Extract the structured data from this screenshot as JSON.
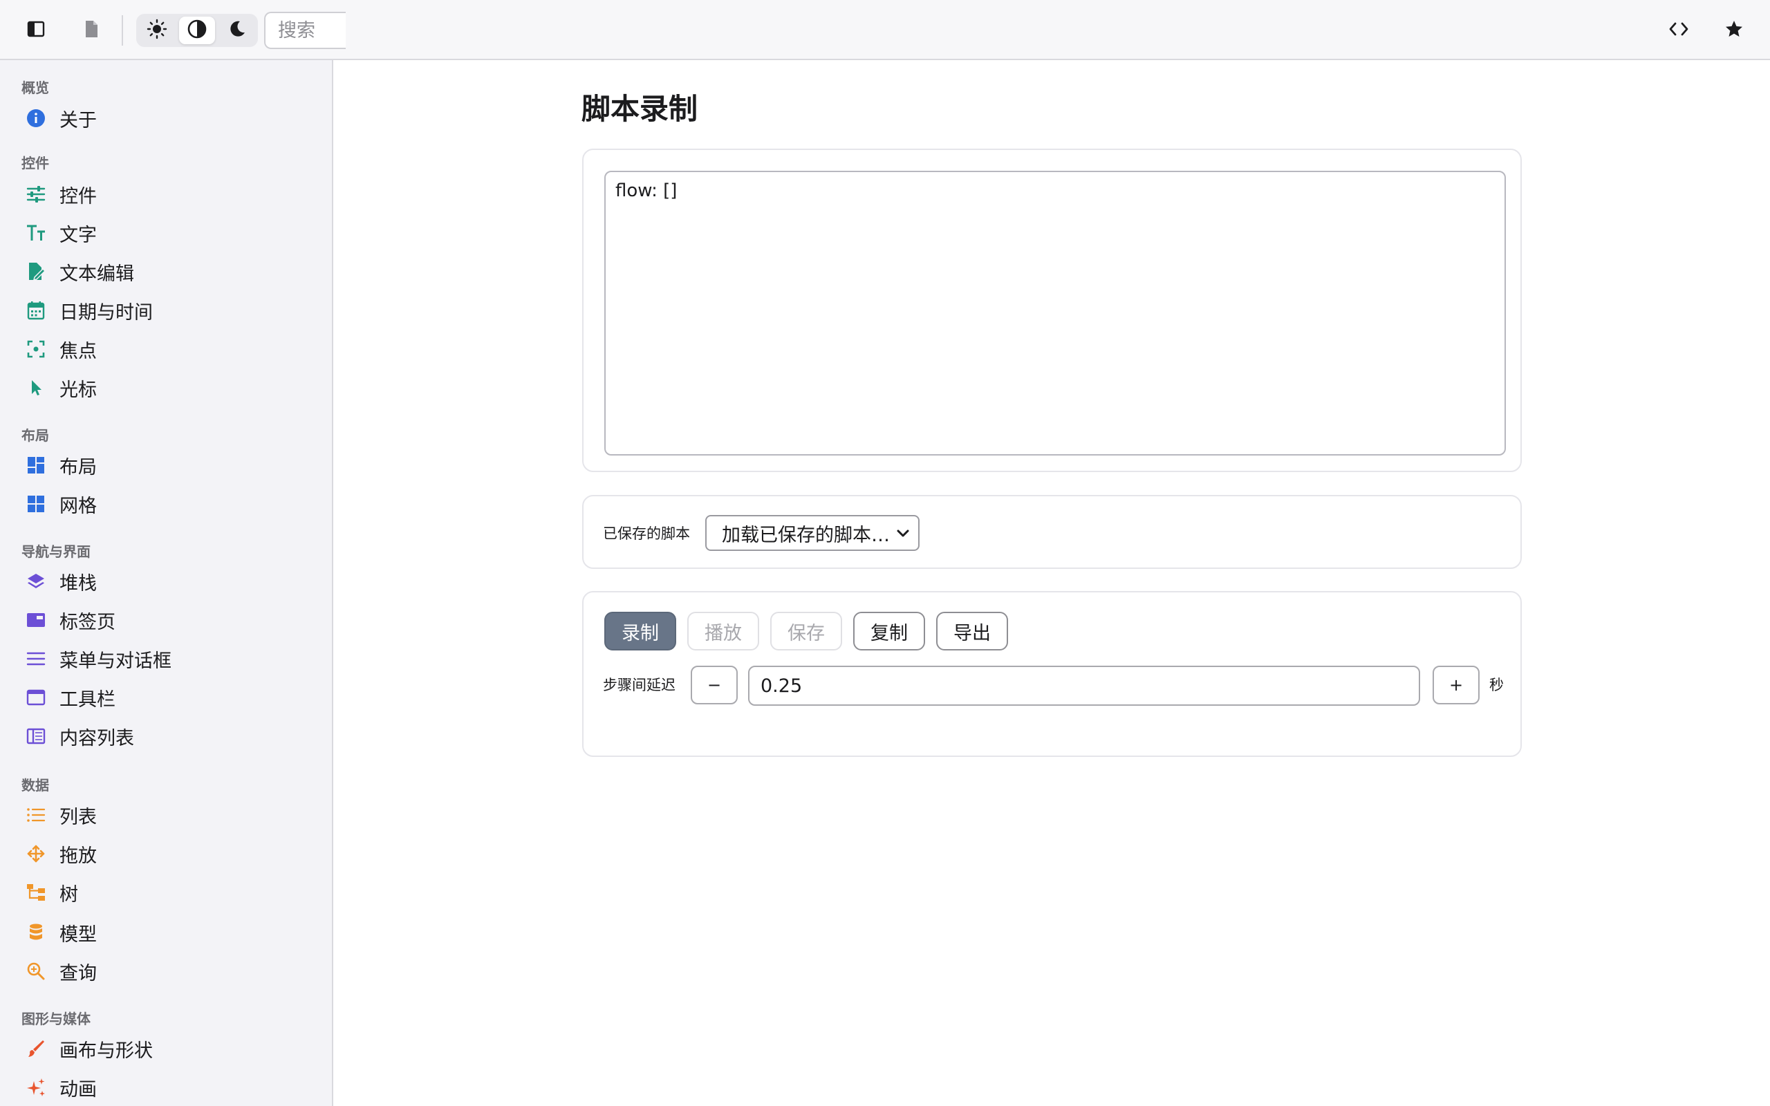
{
  "toolbar": {
    "search_placeholder": "搜索",
    "icons": [
      "sidebar-toggle-icon",
      "document-icon",
      "sun-icon",
      "contrast-icon",
      "moon-icon",
      "code-icon",
      "star-icon"
    ]
  },
  "sidebar": {
    "sections": [
      {
        "title": "概览",
        "items": [
          {
            "label": "关于",
            "icon": "info-icon",
            "color": "#2f6fde"
          }
        ]
      },
      {
        "title": "控件",
        "items": [
          {
            "label": "控件",
            "icon": "sliders-icon",
            "color": "#1f9a7f"
          },
          {
            "label": "文字",
            "icon": "text-size-icon",
            "color": "#1f9a7f"
          },
          {
            "label": "文本编辑",
            "icon": "edit-document-icon",
            "color": "#1f9a7f"
          },
          {
            "label": "日期与时间",
            "icon": "calendar-icon",
            "color": "#1f9a7f"
          },
          {
            "label": "焦点",
            "icon": "focus-icon",
            "color": "#1f9a7f"
          },
          {
            "label": "光标",
            "icon": "cursor-icon",
            "color": "#1f9a7f"
          }
        ]
      },
      {
        "title": "布局",
        "items": [
          {
            "label": "布局",
            "icon": "layout-grid-icon",
            "color": "#2f6fde"
          },
          {
            "label": "网格",
            "icon": "grid-icon",
            "color": "#2f6fde"
          }
        ]
      },
      {
        "title": "导航与界面",
        "items": [
          {
            "label": "堆栈",
            "icon": "stack-icon",
            "color": "#6c4fd6"
          },
          {
            "label": "标签页",
            "icon": "tabs-icon",
            "color": "#6c4fd6"
          },
          {
            "label": "菜单与对话框",
            "icon": "menu-icon",
            "color": "#6c4fd6"
          },
          {
            "label": "工具栏",
            "icon": "window-icon",
            "color": "#6c4fd6"
          },
          {
            "label": "内容列表",
            "icon": "columns-icon",
            "color": "#6c4fd6"
          }
        ]
      },
      {
        "title": "数据",
        "items": [
          {
            "label": "列表",
            "icon": "list-icon",
            "color": "#f0962a"
          },
          {
            "label": "拖放",
            "icon": "move-icon",
            "color": "#f0962a"
          },
          {
            "label": "树",
            "icon": "tree-icon",
            "color": "#f0962a"
          },
          {
            "label": "模型",
            "icon": "database-icon",
            "color": "#f0962a"
          },
          {
            "label": "查询",
            "icon": "search-zoom-icon",
            "color": "#f0962a"
          }
        ]
      },
      {
        "title": "图形与媒体",
        "items": [
          {
            "label": "画布与形状",
            "icon": "brush-icon",
            "color": "#e8542e"
          },
          {
            "label": "动画",
            "icon": "sparkles-icon",
            "color": "#e8542e"
          }
        ]
      }
    ]
  },
  "main": {
    "title": "脚本录制",
    "script_text": "flow: []",
    "saved_label": "已保存的脚本",
    "saved_select_value": "加载已保存的脚本…",
    "buttons": {
      "record": "录制",
      "play": "播放",
      "save": "保存",
      "copy": "复制",
      "export": "导出"
    },
    "delay_label": "步骤间延迟",
    "delay_value": "0.25",
    "minus": "−",
    "plus": "+",
    "unit": "秒"
  }
}
